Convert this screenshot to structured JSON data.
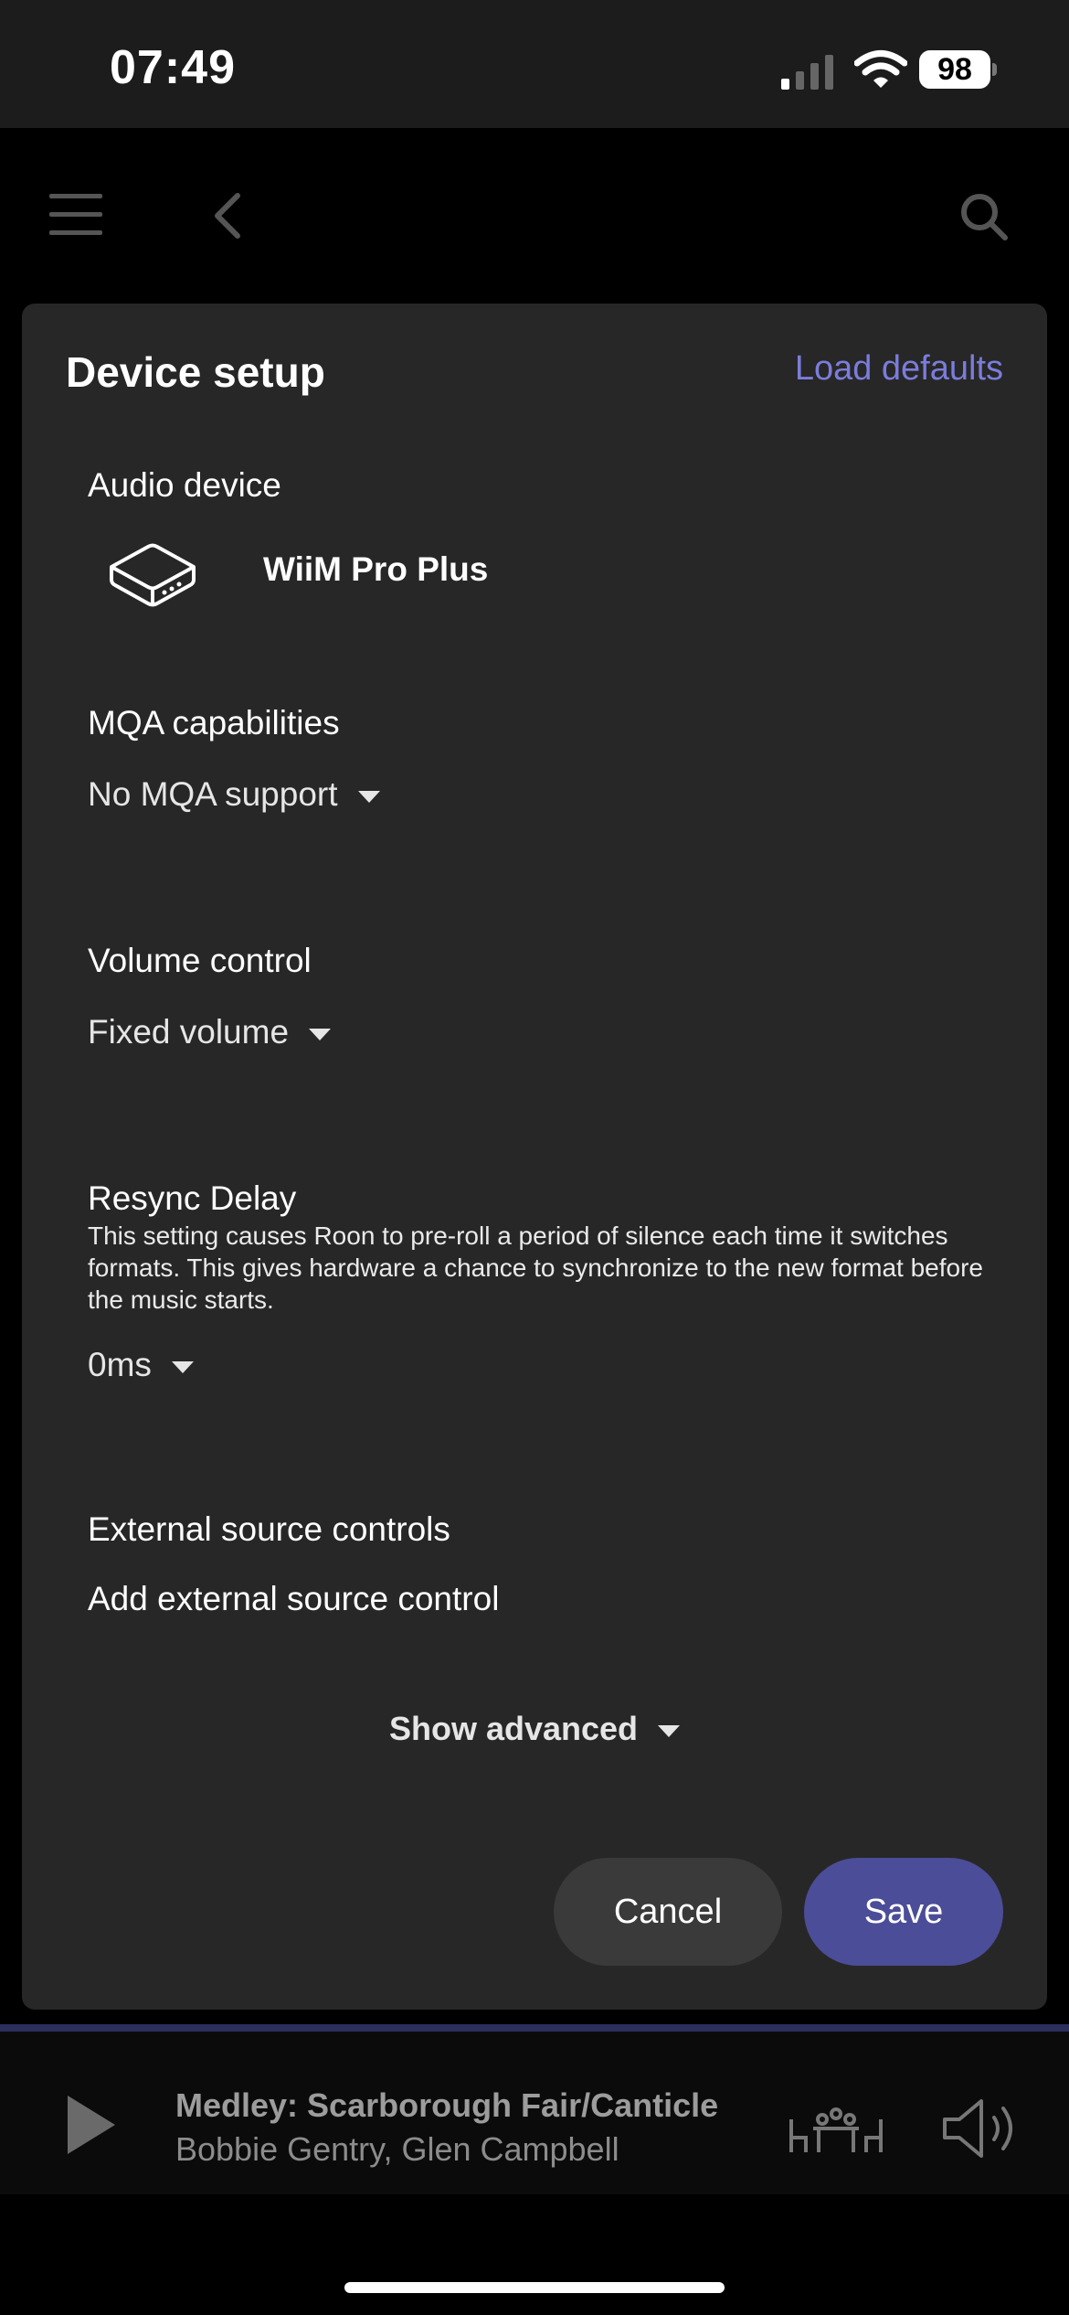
{
  "status_bar": {
    "time": "07:49",
    "battery": "98",
    "signal_icon": "cellular-signal-icon",
    "wifi_icon": "wifi-icon"
  },
  "app_bar": {
    "menu_icon": "hamburger-menu-icon",
    "back_icon": "chevron-left-icon",
    "search_icon": "search-icon"
  },
  "dialog": {
    "title": "Device setup",
    "load_defaults": "Load defaults",
    "audio_device": {
      "label": "Audio device",
      "name": "WiiM Pro Plus",
      "icon": "streamer-box-icon"
    },
    "mqa": {
      "label": "MQA capabilities",
      "value": "No MQA support"
    },
    "volume": {
      "label": "Volume control",
      "value": "Fixed volume"
    },
    "resync": {
      "label": "Resync Delay",
      "description": "This setting causes Roon to pre-roll a period of silence each time it switches formats. This gives hardware a chance to synchronize to the new format before the music starts.",
      "value": "0ms"
    },
    "external": {
      "label": "External source controls",
      "add_link": "Add external source control"
    },
    "show_advanced": "Show advanced",
    "cancel": "Cancel",
    "save": "Save"
  },
  "player": {
    "track": "Medley: Scarborough Fair/Canticle",
    "artist": "Bobbie Gentry, Glen Campbell",
    "play_icon": "play-icon",
    "zone_icon": "zone-speakers-icon",
    "volume_icon": "speaker-volume-icon"
  },
  "colors": {
    "accent": "#7b7ddb",
    "save_button": "#4b4d98",
    "dialog_bg": "#272727"
  }
}
